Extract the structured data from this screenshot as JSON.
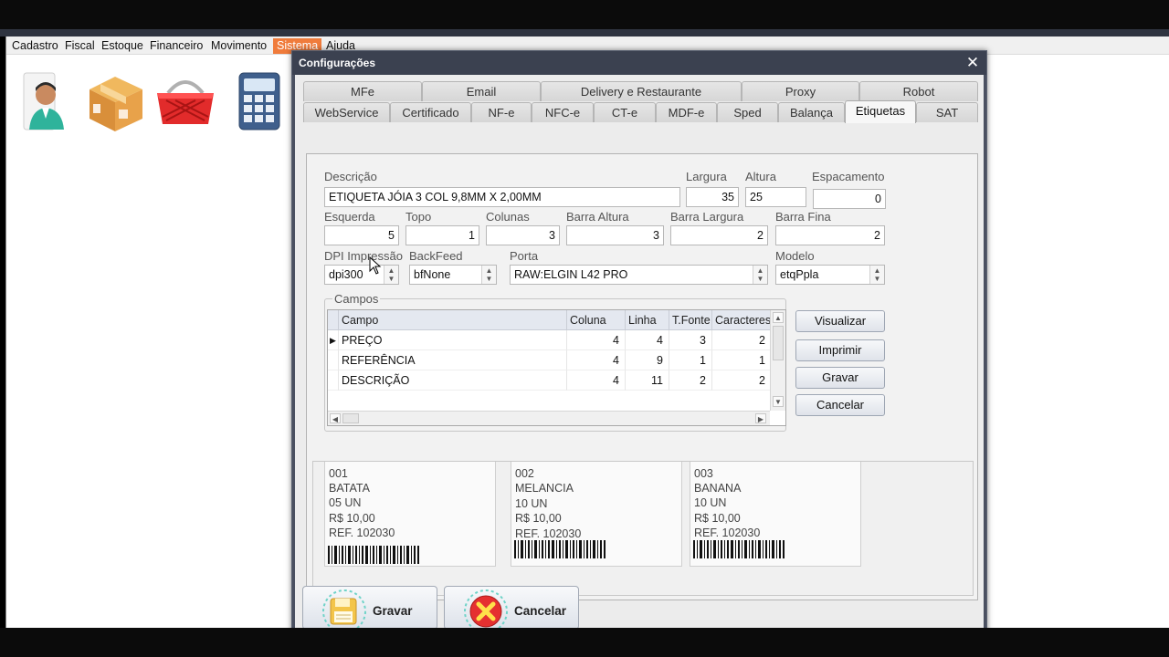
{
  "menubar": {
    "items": [
      "Cadastro",
      "Fiscal",
      "Estoque",
      "Financeiro",
      "Movimento",
      "Sistema",
      "Ajuda"
    ],
    "active": "Sistema"
  },
  "toolbar_icons": [
    "person-icon",
    "box-icon",
    "shopping-basket-icon",
    "calculator-icon"
  ],
  "dialog": {
    "title": "Configurações",
    "close_glyph": "✕",
    "tabs_row1": [
      "MFe",
      "Email",
      "Delivery e Restaurante",
      "Proxy",
      "Robot"
    ],
    "tabs_row2": [
      "WebService",
      "Certificado",
      "NF-e",
      "NFC-e",
      "CT-e",
      "MDF-e",
      "Sped",
      "Balança",
      "Etiquetas",
      "SAT"
    ],
    "selected_tab": "Etiquetas"
  },
  "etiquetas": {
    "descricao_label": "Descrição",
    "descricao": "ETIQUETA JÓIA 3 COL 9,8MM X 2,00MM",
    "largura_label": "Largura",
    "largura": "35",
    "altura_label": "Altura",
    "altura": "25",
    "espacamento_label": "Espacamento",
    "espacamento": "0",
    "esquerda_label": "Esquerda",
    "esquerda": "5",
    "topo_label": "Topo",
    "topo": "1",
    "colunas_label": "Colunas",
    "colunas": "3",
    "barra_altura_label": "Barra Altura",
    "barra_altura": "3",
    "barra_largura_label": "Barra Largura",
    "barra_largura": "2",
    "barra_fina_label": "Barra Fina",
    "barra_fina": "2",
    "dpi_label": "DPI Impressão",
    "dpi": "dpi300",
    "backfeed_label": "BackFeed",
    "backfeed": "bfNone",
    "porta_label": "Porta",
    "porta": "RAW:ELGIN L42 PRO",
    "modelo_label": "Modelo",
    "modelo": "etqPpla"
  },
  "campos": {
    "group_label": "Campos",
    "columns": [
      "Campo",
      "Coluna",
      "Linha",
      "T.Fonte",
      "Caracteres"
    ],
    "rows": [
      {
        "campo": "PREÇO",
        "coluna": "4",
        "linha": "4",
        "tfonte": "3",
        "caracteres": "2"
      },
      {
        "campo": "REFERÊNCIA",
        "coluna": "4",
        "linha": "9",
        "tfonte": "1",
        "caracteres": "1"
      },
      {
        "campo": "DESCRIÇÃO",
        "coluna": "4",
        "linha": "11",
        "tfonte": "2",
        "caracteres": "2"
      }
    ]
  },
  "side_buttons": {
    "visualizar": "Visualizar",
    "imprimir": "Imprimir",
    "gravar": "Gravar",
    "cancelar": "Cancelar"
  },
  "preview_labels": [
    {
      "code": "001",
      "name": "BATATA",
      "qty": "05 UN",
      "price": "R$ 10,00",
      "ref": "REF. 102030"
    },
    {
      "code": "002",
      "name": "MELANCIA",
      "qty": "10 UN",
      "price": "R$ 10,00",
      "ref": "REF. 102030"
    },
    {
      "code": "003",
      "name": "BANANA",
      "qty": "10 UN",
      "price": "R$ 10,00",
      "ref": "REF. 102030"
    }
  ],
  "bottom_buttons": {
    "gravar": "Gravar",
    "cancelar": "Cancelar"
  },
  "colors": {
    "menu_active": "#f07c3c",
    "dialog_title_bar": "#3b4150",
    "cancel_red": "#e53030",
    "save_yellow": "#f3c54a"
  }
}
